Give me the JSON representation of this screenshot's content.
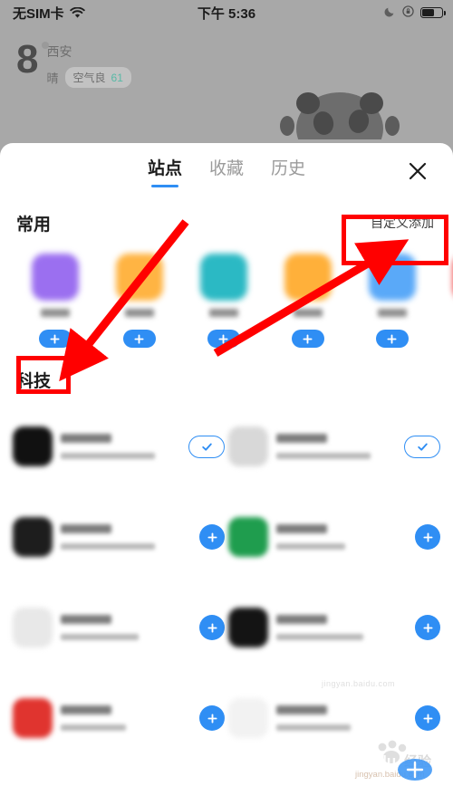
{
  "status_bar": {
    "carrier": "无SIM卡",
    "time": "下午 5:36",
    "icons": [
      "wifi-icon",
      "moon-icon",
      "rotation-lock-icon",
      "battery-icon"
    ]
  },
  "weather": {
    "temperature": "8",
    "city": "西安",
    "condition": "晴",
    "aqi_label": "空气良",
    "aqi_value": "61"
  },
  "sheet": {
    "tabs": [
      {
        "label": "站点",
        "active": true
      },
      {
        "label": "收藏",
        "active": false
      },
      {
        "label": "历史",
        "active": false
      }
    ],
    "close_label": "×",
    "section_common": {
      "title": "常用",
      "custom_add_label": "自定义添加",
      "items": [
        {
          "color": "#9b6ff0",
          "add_label": "+"
        },
        {
          "color": "#ffb443",
          "add_label": "+"
        },
        {
          "color": "#2bb9c4",
          "add_label": "+"
        },
        {
          "color": "#ffb03a",
          "add_label": "+"
        },
        {
          "color": "#5aa9f8",
          "add_label": "+"
        },
        {
          "color": "#ef3b3b",
          "add_label": "+"
        }
      ]
    },
    "section_tech": {
      "title": "科技",
      "items": [
        {
          "color": "#111111",
          "action": "check",
          "action_label": "✓"
        },
        {
          "color": "#d8d8d8",
          "action": "check",
          "action_label": "✓"
        },
        {
          "color": "#1d1d1d",
          "action": "add",
          "action_label": "+"
        },
        {
          "color": "#1f9d4e",
          "action": "add",
          "action_label": "+"
        },
        {
          "color": "#e8e8e8",
          "action": "add",
          "action_label": "+"
        },
        {
          "color": "#141414",
          "action": "add",
          "action_label": "+"
        },
        {
          "color": "#e0342f",
          "action": "add",
          "action_label": "+"
        },
        {
          "color": "#f2f2f2",
          "action": "add",
          "action_label": "+"
        }
      ]
    }
  },
  "annotations": {
    "accent_color": "#ff0000",
    "box_custom_add": "自定义添加",
    "box_first_plus": "+"
  },
  "watermark": {
    "center_line1": "jingyan.baidu.com",
    "corner_text": "Baidu 经验",
    "corner_sub": "jingyan.baidu.com"
  }
}
